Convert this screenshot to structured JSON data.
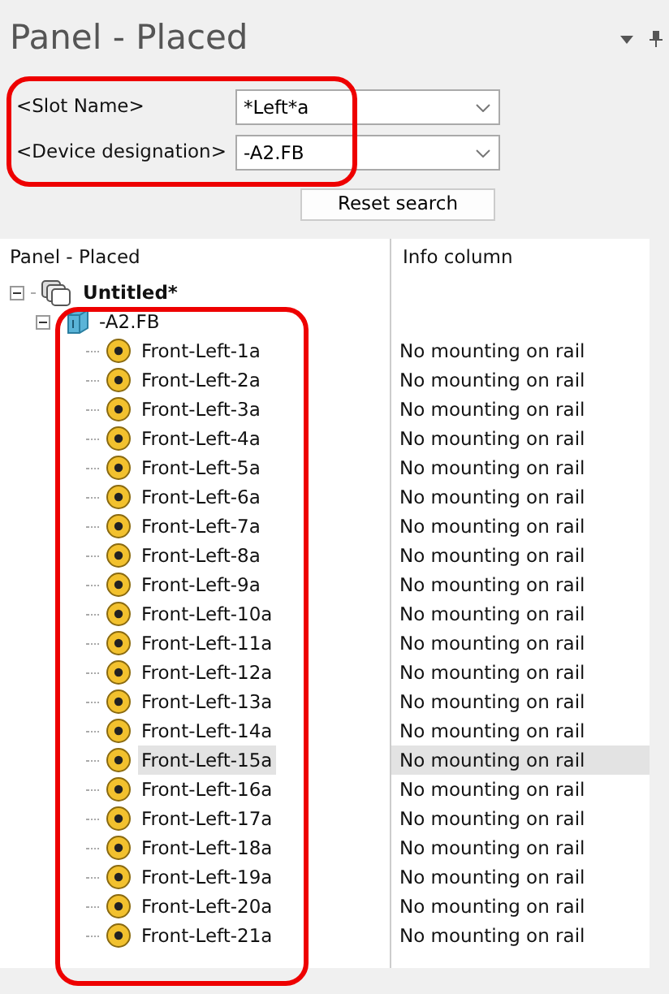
{
  "panel": {
    "title": "Panel - Placed"
  },
  "filters": [
    {
      "label": "<Slot Name>",
      "value": "*Left*a"
    },
    {
      "label": "<Device designation>",
      "value": "-A2.FB"
    }
  ],
  "reset_button": "Reset search",
  "tree": {
    "columns": [
      "Panel - Placed",
      "Info column"
    ],
    "nodes": [
      {
        "label": "Untitled*",
        "kind": "project",
        "expanded": true,
        "children": [
          {
            "label": "-A2.FB",
            "kind": "device",
            "expanded": true,
            "children": [
              {
                "label": "Front-Left-1a",
                "info": "No mounting on rail",
                "kind": "slot",
                "selected": false
              },
              {
                "label": "Front-Left-2a",
                "info": "No mounting on rail",
                "kind": "slot",
                "selected": false
              },
              {
                "label": "Front-Left-3a",
                "info": "No mounting on rail",
                "kind": "slot",
                "selected": false
              },
              {
                "label": "Front-Left-4a",
                "info": "No mounting on rail",
                "kind": "slot",
                "selected": false
              },
              {
                "label": "Front-Left-5a",
                "info": "No mounting on rail",
                "kind": "slot",
                "selected": false
              },
              {
                "label": "Front-Left-6a",
                "info": "No mounting on rail",
                "kind": "slot",
                "selected": false
              },
              {
                "label": "Front-Left-7a",
                "info": "No mounting on rail",
                "kind": "slot",
                "selected": false
              },
              {
                "label": "Front-Left-8a",
                "info": "No mounting on rail",
                "kind": "slot",
                "selected": false
              },
              {
                "label": "Front-Left-9a",
                "info": "No mounting on rail",
                "kind": "slot",
                "selected": false
              },
              {
                "label": "Front-Left-10a",
                "info": "No mounting on rail",
                "kind": "slot",
                "selected": false
              },
              {
                "label": "Front-Left-11a",
                "info": "No mounting on rail",
                "kind": "slot",
                "selected": false
              },
              {
                "label": "Front-Left-12a",
                "info": "No mounting on rail",
                "kind": "slot",
                "selected": false
              },
              {
                "label": "Front-Left-13a",
                "info": "No mounting on rail",
                "kind": "slot",
                "selected": false
              },
              {
                "label": "Front-Left-14a",
                "info": "No mounting on rail",
                "kind": "slot",
                "selected": false
              },
              {
                "label": "Front-Left-15a",
                "info": "No mounting on rail",
                "kind": "slot",
                "selected": true
              },
              {
                "label": "Front-Left-16a",
                "info": "No mounting on rail",
                "kind": "slot",
                "selected": false
              },
              {
                "label": "Front-Left-17a",
                "info": "No mounting on rail",
                "kind": "slot",
                "selected": false
              },
              {
                "label": "Front-Left-18a",
                "info": "No mounting on rail",
                "kind": "slot",
                "selected": false
              },
              {
                "label": "Front-Left-19a",
                "info": "No mounting on rail",
                "kind": "slot",
                "selected": false
              },
              {
                "label": "Front-Left-20a",
                "info": "No mounting on rail",
                "kind": "slot",
                "selected": false
              },
              {
                "label": "Front-Left-21a",
                "info": "No mounting on rail",
                "kind": "slot",
                "selected": false
              }
            ]
          }
        ]
      }
    ]
  }
}
